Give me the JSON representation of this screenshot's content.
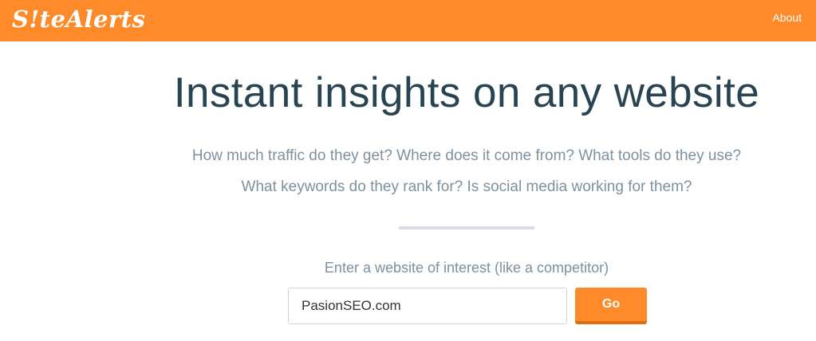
{
  "header": {
    "logo_text": "S!teAlerts",
    "about_label": "About"
  },
  "hero": {
    "headline": "Instant insights on any website",
    "subtitle_line1": "How much traffic do they get? Where does it come from? What tools do they use?",
    "subtitle_line2": "What keywords do they rank for? Is social media working for them?"
  },
  "search": {
    "prompt": "Enter a website of interest (like a competitor)",
    "input_value": "PasionSEO.com",
    "button_label": "Go"
  },
  "colors": {
    "brand_orange": "#ff8a2a",
    "heading": "#284452",
    "muted_text": "#7e91a0",
    "divider": "#d9dde3"
  }
}
